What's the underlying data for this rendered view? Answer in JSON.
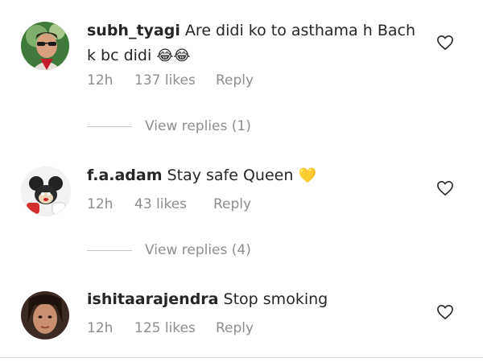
{
  "comments": [
    {
      "username": "subh_tyagi",
      "text": "Are didi ko to asthama h Bach k bc didi",
      "emoji": "😂😂",
      "time": "12h",
      "likes": "137 likes",
      "reply": "Reply",
      "view_replies": "View replies (1)"
    },
    {
      "username": "f.a.adam",
      "text": "Stay safe Queen",
      "emoji": "💛",
      "time": "12h",
      "likes": "43 likes",
      "reply": "Reply",
      "view_replies": "View replies (4)"
    },
    {
      "username": "ishitaarajendra",
      "text": "Stop smoking",
      "emoji": "",
      "time": "12h",
      "likes": "125 likes",
      "reply": "Reply",
      "view_replies": ""
    }
  ],
  "icons": {
    "like": "heart-outline-icon"
  },
  "colors": {
    "text": "#262626",
    "muted": "#8e8e8e",
    "heart_emoji": "#f5c518"
  }
}
